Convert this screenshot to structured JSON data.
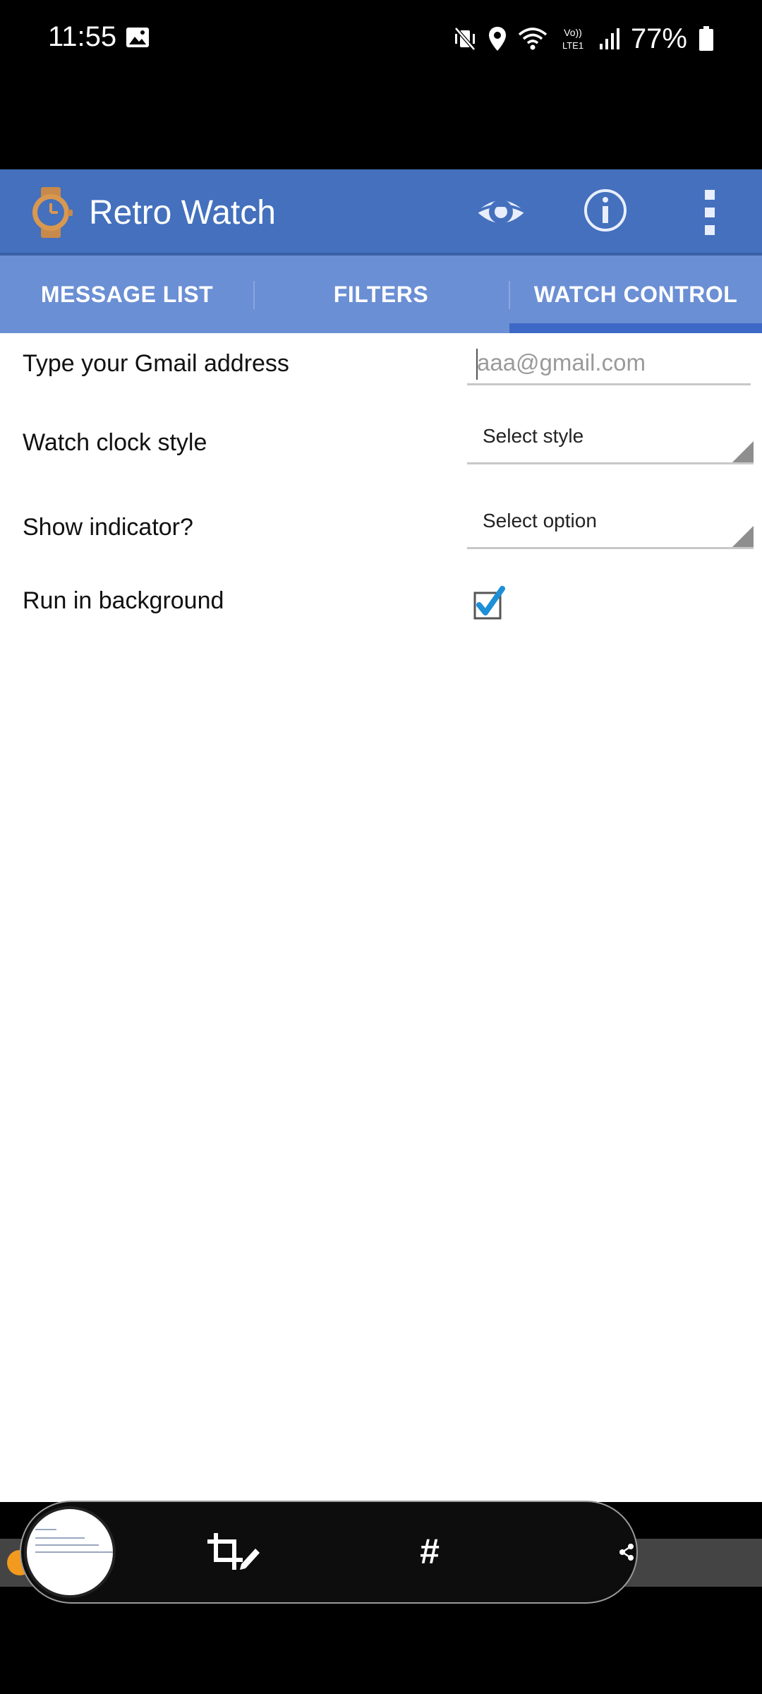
{
  "status_bar": {
    "time": "11:55",
    "battery": "77%",
    "icons": [
      "gallery-icon",
      "mute-vibrate-icon",
      "location-icon",
      "wifi-icon",
      "volte-icon",
      "signal-icon",
      "battery-icon"
    ],
    "volte_line1": "Vo))",
    "volte_line2": "LTE1"
  },
  "app_bar": {
    "title": "Retro Watch",
    "color": "#4470bd",
    "actions": [
      "eye-icon",
      "info-icon",
      "overflow-menu-icon"
    ]
  },
  "tabs": [
    {
      "label": "MESSAGE LIST",
      "selected": false
    },
    {
      "label": "FILTERS",
      "selected": false
    },
    {
      "label": "WATCH CONTROL",
      "selected": true
    }
  ],
  "form": {
    "gmail_label": "Type your Gmail address",
    "gmail_placeholder": "aaa@gmail.com",
    "gmail_value": "",
    "clock_style_label": "Watch clock style",
    "clock_style_value": "Select style",
    "indicator_label": "Show indicator?",
    "indicator_value": "Select option",
    "background_label": "Run in background",
    "background_checked": true
  },
  "screenshot_toolbar": {
    "hash_label": "#",
    "icons": [
      "screenshot-thumbnail",
      "crop-edit-icon",
      "hashtag-icon",
      "share-icon"
    ]
  }
}
